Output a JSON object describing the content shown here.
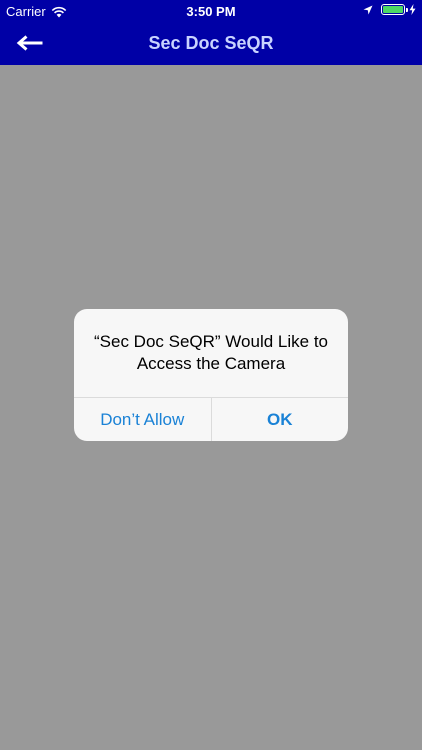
{
  "status_bar": {
    "carrier": "Carrier",
    "time": "3:50 PM",
    "battery_level": 1.0,
    "icons": [
      "wifi-icon",
      "location-arrow-icon",
      "battery-icon",
      "charging-bolt-icon"
    ]
  },
  "nav": {
    "title": "Sec Doc SeQR",
    "back_icon": "arrow-left-icon"
  },
  "alert": {
    "title": "“Sec Doc SeQR” Would Like to Access the Camera",
    "buttons": {
      "deny_label": "Don’t Allow",
      "ok_label": "OK"
    }
  },
  "colors": {
    "nav_background": "#0000a6",
    "nav_title": "#c9d3ff",
    "screen_background": "#999999",
    "alert_background": "#f7f7f7",
    "alert_button_text": "#1a82d6",
    "battery_fill": "#4cd964"
  }
}
